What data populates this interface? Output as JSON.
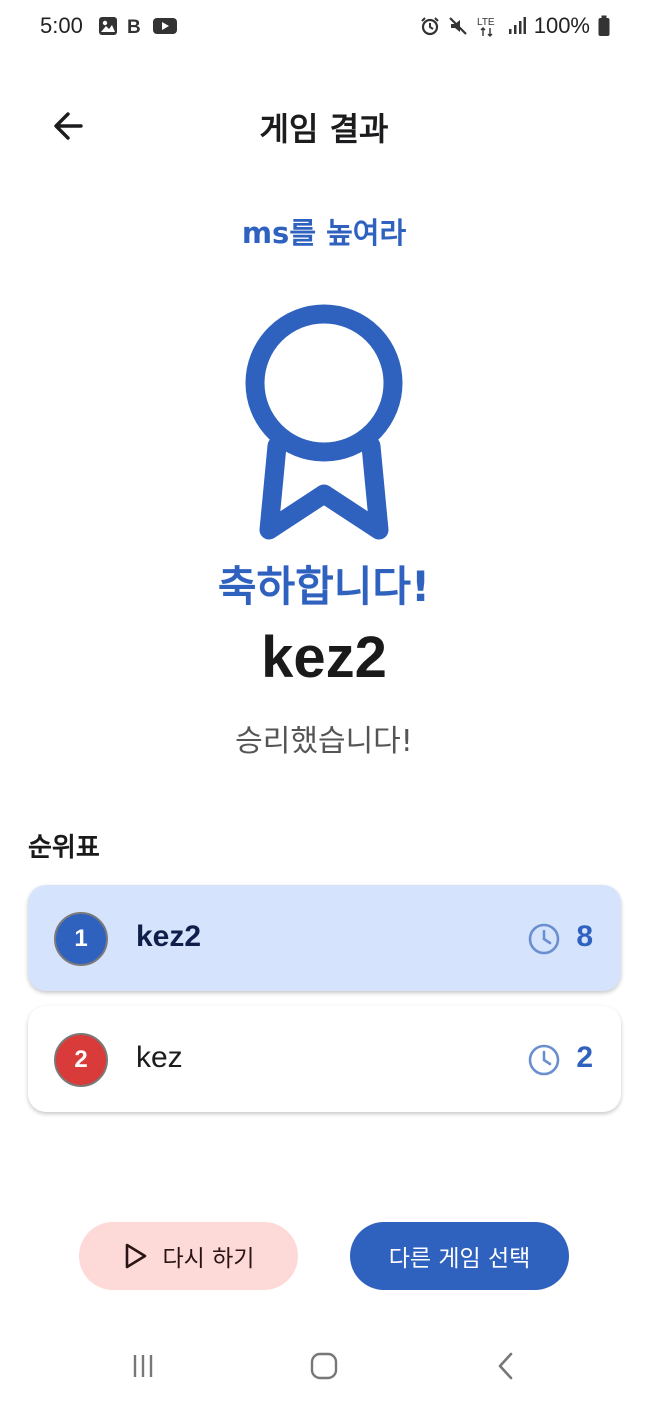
{
  "status_bar": {
    "time": "5:00",
    "battery": "100%",
    "left_icons": [
      "gallery-icon",
      "b-icon",
      "youtube-icon"
    ],
    "right_icons": [
      "alarm-icon",
      "mute-icon",
      "lte-icon",
      "signal-icon",
      "battery-icon"
    ]
  },
  "app_bar": {
    "title": "게임 결과",
    "back_icon": "arrow-back-icon"
  },
  "game": {
    "name": "ms를 높여라"
  },
  "result": {
    "award_icon": "award-ribbon-icon",
    "congrats": "축하합니다!",
    "winner": "kez2",
    "subtitle": "승리했습니다!"
  },
  "leaderboard": {
    "title": "순위표",
    "rows": [
      {
        "rank": "1",
        "name": "kez2",
        "score": "8",
        "badge_color": "#2f62bf"
      },
      {
        "rank": "2",
        "name": "kez",
        "score": "2",
        "badge_color": "#d93a3a"
      }
    ]
  },
  "actions": {
    "retry_label": "다시 하기",
    "other_label": "다른 게임 선택"
  },
  "colors": {
    "accent": "#2f62bf",
    "highlight_row": "#d6e3fd",
    "retry_bg": "#fdd9d8"
  },
  "nav_bar": {
    "icons": [
      "recent-apps-icon",
      "home-icon",
      "back-nav-icon"
    ]
  }
}
